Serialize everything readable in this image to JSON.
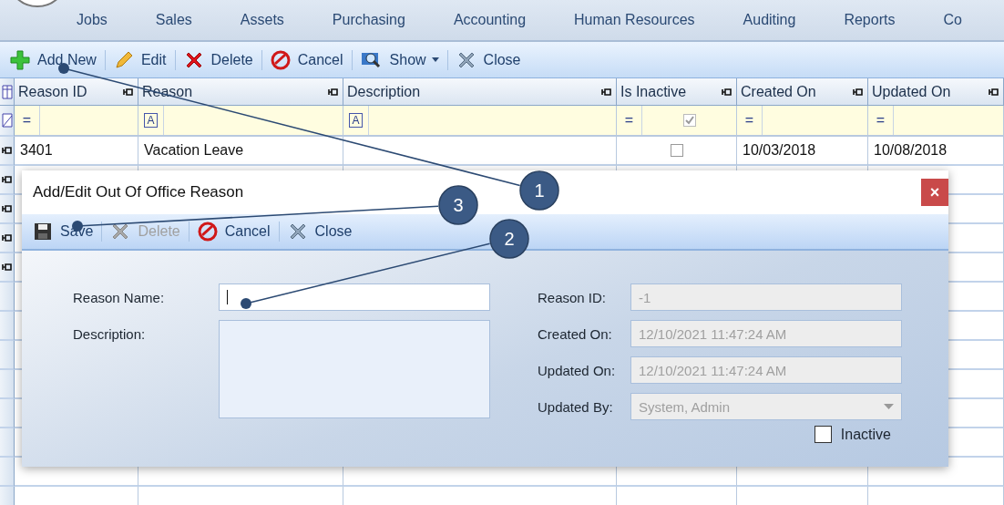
{
  "menu": [
    {
      "label": "Jobs"
    },
    {
      "label": "Sales"
    },
    {
      "label": "Assets"
    },
    {
      "label": "Purchasing"
    },
    {
      "label": "Accounting"
    },
    {
      "label": "Human Resources"
    },
    {
      "label": "Auditing"
    },
    {
      "label": "Reports"
    },
    {
      "label": "Co"
    }
  ],
  "toolbar": [
    {
      "kind": "add",
      "label": "Add New",
      "disabled": false
    },
    {
      "kind": "edit",
      "label": "Edit",
      "disabled": false
    },
    {
      "kind": "delete",
      "label": "Delete",
      "disabled": false
    },
    {
      "kind": "cancel",
      "label": "Cancel",
      "disabled": false
    },
    {
      "kind": "show",
      "label": "Show",
      "disabled": false
    },
    {
      "kind": "close",
      "label": "Close",
      "disabled": false
    }
  ],
  "table": {
    "columns": [
      {
        "label": "Reason ID",
        "filter": "="
      },
      {
        "label": "Reason",
        "filter": "A"
      },
      {
        "label": "Description",
        "filter": "A"
      },
      {
        "label": "Is Inactive",
        "filter": "=",
        "filter_checked": true
      },
      {
        "label": "Created On",
        "filter": "="
      },
      {
        "label": "Updated On",
        "filter": "="
      }
    ],
    "rows": [
      {
        "cells": [
          "3401",
          "Vacation Leave",
          "",
          "",
          "10/03/2018",
          "10/08/2018"
        ],
        "is_inactive": false
      }
    ]
  },
  "dialog": {
    "title": "Add/Edit Out Of Office Reason",
    "close": "×",
    "toolbar": [
      {
        "kind": "save",
        "label": "Save",
        "disabled": false
      },
      {
        "kind": "delete",
        "label": "Delete",
        "disabled": true
      },
      {
        "kind": "cancel",
        "label": "Cancel",
        "disabled": false
      },
      {
        "kind": "close",
        "label": "Close",
        "disabled": false
      }
    ],
    "left_fields": [
      {
        "kind": "text",
        "label": "Reason Name:",
        "focused": true
      },
      {
        "kind": "textarea",
        "label": "Description:"
      }
    ],
    "right_fields": [
      {
        "kind": "text",
        "label": "Reason ID:",
        "value": "-1",
        "disabled": true
      },
      {
        "kind": "text",
        "label": "Created On:",
        "value": "12/10/2021 11:47:24 AM",
        "disabled": true
      },
      {
        "kind": "text",
        "label": "Updated On:",
        "value": "12/10/2021 11:47:24 AM",
        "disabled": true
      },
      {
        "kind": "select",
        "label": "Updated By:",
        "value": "System, Admin",
        "disabled": true
      }
    ],
    "inactive": {
      "label": "Inactive",
      "checked": false
    }
  },
  "callouts": [
    {
      "number": "1"
    },
    {
      "number": "2"
    },
    {
      "number": "3"
    }
  ]
}
